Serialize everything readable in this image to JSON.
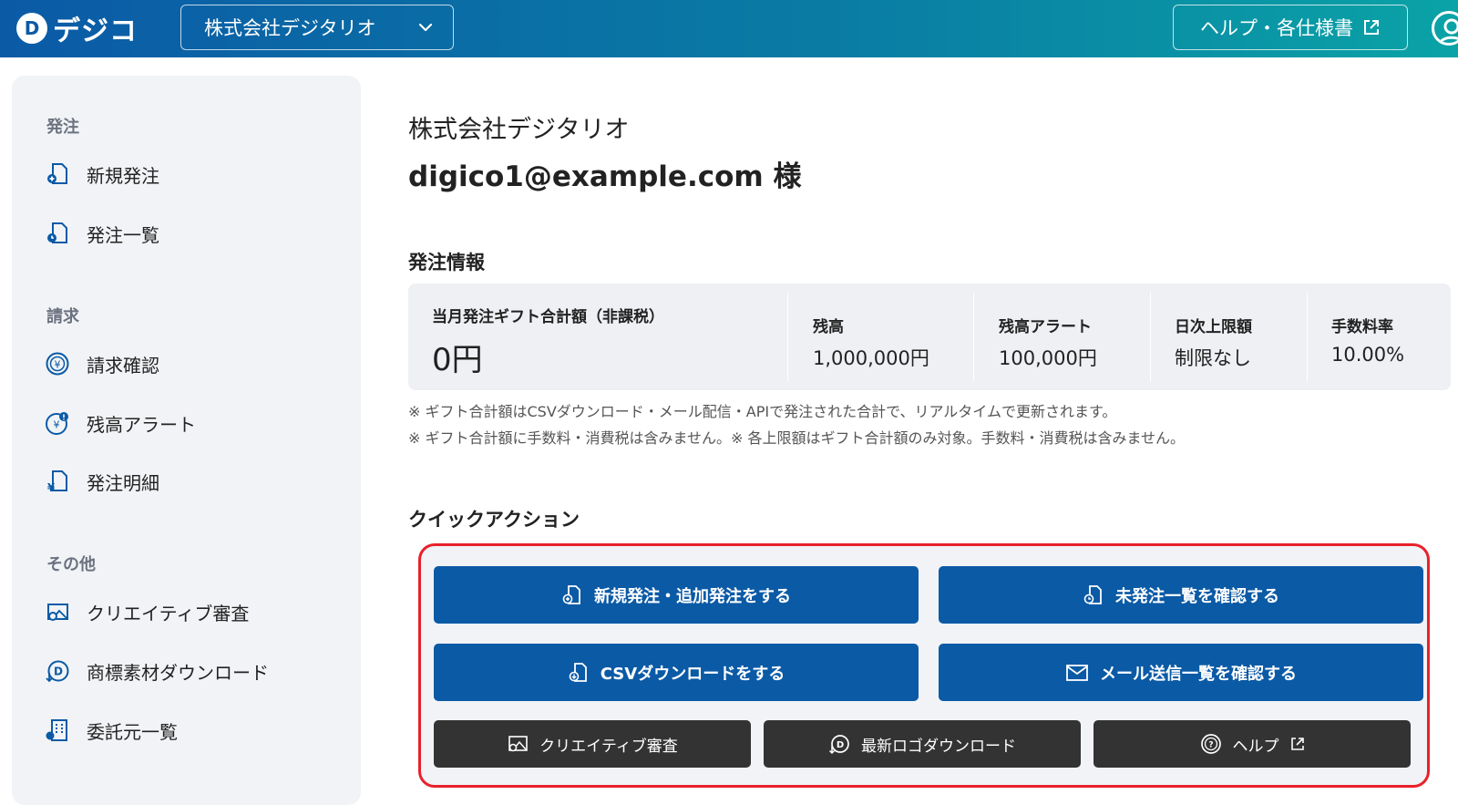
{
  "header": {
    "logo_text": "デジコ",
    "logo_mark": "D",
    "company_select": "株式会社デジタリオ",
    "help_button": "ヘルプ・各仕様書"
  },
  "sidebar": {
    "sections": [
      {
        "title": "発注",
        "items": [
          {
            "label": "新規発注",
            "icon": "doc-plus-icon"
          },
          {
            "label": "発注一覧",
            "icon": "doc-clock-icon"
          }
        ]
      },
      {
        "title": "請求",
        "items": [
          {
            "label": "請求確認",
            "icon": "yen-circle-icon"
          },
          {
            "label": "残高アラート",
            "icon": "yen-alert-icon"
          },
          {
            "label": "発注明細",
            "icon": "doc-yen-icon"
          }
        ]
      },
      {
        "title": "その他",
        "items": [
          {
            "label": "クリエイティブ審査",
            "icon": "image-search-icon"
          },
          {
            "label": "商標素材ダウンロード",
            "icon": "logo-download-icon"
          },
          {
            "label": "委託元一覧",
            "icon": "building-icon"
          }
        ]
      }
    ]
  },
  "main": {
    "company": "株式会社デジタリオ",
    "user": "digico1@example.com 様",
    "order_info_title": "発注情報",
    "order_info": [
      {
        "label": "当月発注ギフト合計額（非課税）",
        "value": "0円"
      },
      {
        "label": "残高",
        "value": "1,000,000円"
      },
      {
        "label": "残高アラート",
        "value": "100,000円"
      },
      {
        "label": "日次上限額",
        "value": "制限なし"
      },
      {
        "label": "手数料率",
        "value": "10.00%"
      }
    ],
    "notes": [
      "※ ギフト合計額はCSVダウンロード・メール配信・APIで発注された合計で、リアルタイムで更新されます。",
      "※ ギフト合計額に手数料・消費税は含みません。※ 各上限額はギフト合計額のみ対象。手数料・消費税は含みません。"
    ],
    "quick_action_title": "クイックアクション",
    "quick_actions": {
      "new_order": "新規発注・追加発注をする",
      "unordered_list": "未発注一覧を確認する",
      "csv_download": "CSVダウンロードをする",
      "mail_list": "メール送信一覧を確認する",
      "creative_review": "クリエイティブ審査",
      "logo_download": "最新ロゴダウンロード",
      "help": "ヘルプ"
    }
  },
  "colors": {
    "header_start": "#0b5aa6",
    "header_end": "#0aa3a6",
    "primary_button": "#0b5aa6",
    "dark_button": "#333333",
    "highlight_border": "#e8212a",
    "sidebar_bg": "#f1f3f6"
  }
}
